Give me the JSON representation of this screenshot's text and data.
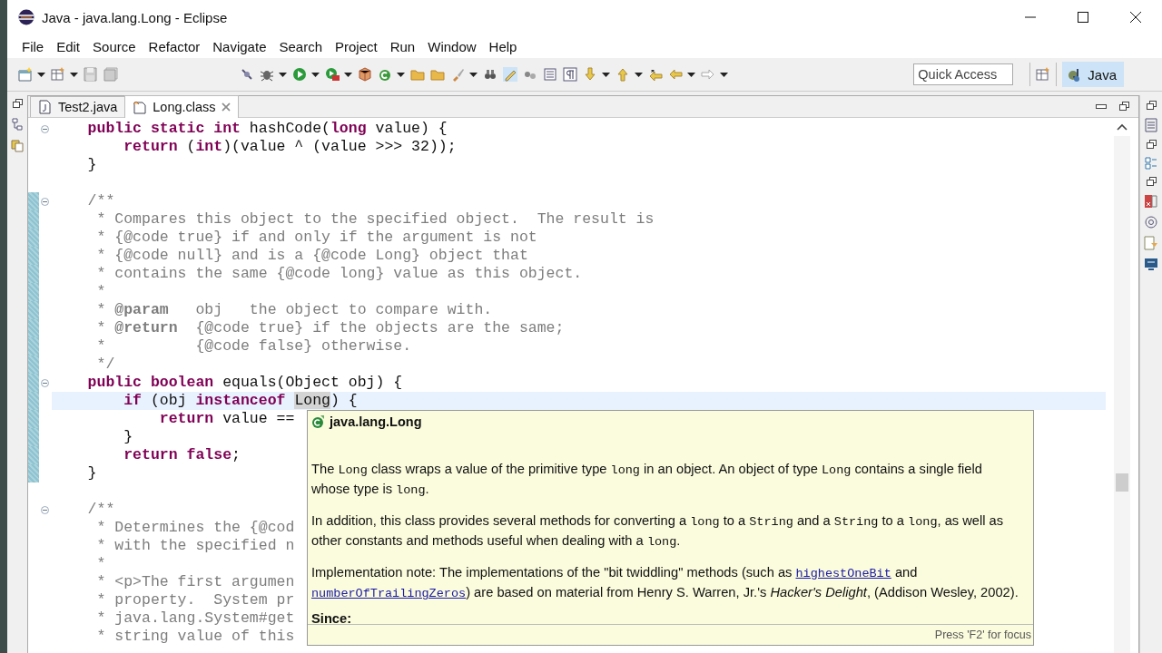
{
  "window": {
    "title": "Java - java.lang.Long - Eclipse"
  },
  "menu": [
    "File",
    "Edit",
    "Source",
    "Refactor",
    "Navigate",
    "Search",
    "Project",
    "Run",
    "Window",
    "Help"
  ],
  "quick_access": {
    "placeholder": "Quick Access"
  },
  "perspective": {
    "label": "Java",
    "selected": true
  },
  "tabs": [
    {
      "label": "Test2.java",
      "kind": "java",
      "selected": false
    },
    {
      "label": "Long.class",
      "kind": "class",
      "selected": true
    }
  ],
  "code_lines": [
    {
      "fold": true,
      "changed": false,
      "highlighted": false,
      "segments": [
        {
          "kind": "keyword",
          "text": "    public static int"
        },
        {
          "kind": "code",
          "text": " hashCode("
        },
        {
          "kind": "keyword",
          "text": "long"
        },
        {
          "kind": "code",
          "text": " value) {"
        }
      ]
    },
    {
      "fold": false,
      "changed": false,
      "highlighted": false,
      "segments": [
        {
          "kind": "keyword",
          "text": "        return"
        },
        {
          "kind": "code",
          "text": " ("
        },
        {
          "kind": "keyword",
          "text": "int"
        },
        {
          "kind": "code",
          "text": ")(value ^ (value >>> 32));"
        }
      ]
    },
    {
      "fold": false,
      "changed": false,
      "highlighted": false,
      "segments": [
        {
          "kind": "code",
          "text": "    }"
        }
      ]
    },
    {
      "fold": false,
      "changed": false,
      "highlighted": false
    },
    {
      "fold": true,
      "changed": true,
      "highlighted": false,
      "segments": [
        {
          "kind": "comment",
          "text": "    /**"
        }
      ]
    },
    {
      "fold": false,
      "changed": true,
      "highlighted": false,
      "segments": [
        {
          "kind": "comment",
          "text": "     * Compares this object to the specified object.  The result is"
        }
      ]
    },
    {
      "fold": false,
      "changed": true,
      "highlighted": false,
      "segments": [
        {
          "kind": "comment",
          "text": "     * {@code true} if and only if the argument is not"
        }
      ]
    },
    {
      "fold": false,
      "changed": true,
      "highlighted": false,
      "segments": [
        {
          "kind": "comment",
          "text": "     * {@code null} and is a {@code Long} object that"
        }
      ]
    },
    {
      "fold": false,
      "changed": true,
      "highlighted": false,
      "segments": [
        {
          "kind": "comment",
          "text": "     * contains the same {@code long} value as this object."
        }
      ]
    },
    {
      "fold": false,
      "changed": true,
      "highlighted": false,
      "segments": [
        {
          "kind": "comment",
          "text": "     *"
        }
      ]
    },
    {
      "fold": false,
      "changed": true,
      "highlighted": false,
      "segments": [
        {
          "kind": "comment",
          "text": "     * "
        },
        {
          "kind": "tag",
          "text": "@param"
        },
        {
          "kind": "comment",
          "text": "   obj   the object to compare with."
        }
      ]
    },
    {
      "fold": false,
      "changed": true,
      "highlighted": false,
      "segments": [
        {
          "kind": "comment",
          "text": "     * "
        },
        {
          "kind": "tag",
          "text": "@return"
        },
        {
          "kind": "comment",
          "text": "  {@code true} if the objects are the same;"
        }
      ]
    },
    {
      "fold": false,
      "changed": true,
      "highlighted": false,
      "segments": [
        {
          "kind": "comment",
          "text": "     *          {@code false} otherwise."
        }
      ]
    },
    {
      "fold": false,
      "changed": true,
      "highlighted": false,
      "segments": [
        {
          "kind": "comment",
          "text": "     */"
        }
      ]
    },
    {
      "fold": true,
      "changed": true,
      "highlighted": false,
      "segments": [
        {
          "kind": "keyword",
          "text": "    public boolean"
        },
        {
          "kind": "code",
          "text": " equals(Object obj) {"
        }
      ]
    },
    {
      "fold": false,
      "changed": true,
      "highlighted": true,
      "segments": [
        {
          "kind": "keyword",
          "text": "        if"
        },
        {
          "kind": "code",
          "text": " (obj "
        },
        {
          "kind": "keyword",
          "text": "instanceof "
        },
        {
          "kind": "occurrence",
          "text": "Long"
        },
        {
          "kind": "code",
          "text": ") {"
        }
      ]
    },
    {
      "fold": false,
      "changed": true,
      "highlighted": false,
      "segments": [
        {
          "kind": "keyword",
          "text": "            return"
        },
        {
          "kind": "code",
          "text": " value =="
        }
      ]
    },
    {
      "fold": false,
      "changed": true,
      "highlighted": false,
      "segments": [
        {
          "kind": "code",
          "text": "        }"
        }
      ]
    },
    {
      "fold": false,
      "changed": true,
      "highlighted": false,
      "segments": [
        {
          "kind": "keyword",
          "text": "        return false"
        },
        {
          "kind": "code",
          "text": ";"
        }
      ]
    },
    {
      "fold": false,
      "changed": true,
      "highlighted": false,
      "segments": [
        {
          "kind": "code",
          "text": "    }"
        }
      ]
    },
    {
      "fold": false,
      "changed": false,
      "highlighted": false
    },
    {
      "fold": true,
      "changed": false,
      "highlighted": false,
      "segments": [
        {
          "kind": "comment",
          "text": "    /**"
        }
      ]
    },
    {
      "fold": false,
      "changed": false,
      "highlighted": false,
      "segments": [
        {
          "kind": "comment",
          "text": "     * Determines the {@cod"
        }
      ]
    },
    {
      "fold": false,
      "changed": false,
      "highlighted": false,
      "segments": [
        {
          "kind": "comment",
          "text": "     * with the specified n"
        }
      ]
    },
    {
      "fold": false,
      "changed": false,
      "highlighted": false,
      "segments": [
        {
          "kind": "comment",
          "text": "     *"
        }
      ]
    },
    {
      "fold": false,
      "changed": false,
      "highlighted": false,
      "segments": [
        {
          "kind": "comment",
          "text": "     * <p>The first argumen"
        }
      ]
    },
    {
      "fold": false,
      "changed": false,
      "highlighted": false,
      "segments": [
        {
          "kind": "comment",
          "text": "     * property.  System pr"
        }
      ]
    },
    {
      "fold": false,
      "changed": false,
      "highlighted": false,
      "segments": [
        {
          "kind": "comment",
          "text": "     * java.lang.System#get"
        }
      ]
    },
    {
      "fold": false,
      "changed": false,
      "highlighted": false,
      "segments": [
        {
          "kind": "comment",
          "text": "     * string value of this"
        }
      ]
    }
  ],
  "hover_popup": {
    "title": "java.lang.Long",
    "paragraphs": [
      [
        {
          "kind": "text",
          "text": "The "
        },
        {
          "kind": "code",
          "text": "Long"
        },
        {
          "kind": "text",
          "text": " class wraps a value of the primitive type "
        },
        {
          "kind": "code",
          "text": "long"
        },
        {
          "kind": "text",
          "text": " in an object. An object of type "
        },
        {
          "kind": "code",
          "text": "Long"
        },
        {
          "kind": "text",
          "text": " contains a single field whose type is "
        },
        {
          "kind": "code",
          "text": "long"
        },
        {
          "kind": "text",
          "text": "."
        }
      ],
      [
        {
          "kind": "text",
          "text": "In addition, this class provides several methods for converting a "
        },
        {
          "kind": "code",
          "text": "long"
        },
        {
          "kind": "text",
          "text": " to a "
        },
        {
          "kind": "code",
          "text": "String"
        },
        {
          "kind": "text",
          "text": " and a "
        },
        {
          "kind": "code",
          "text": "String"
        },
        {
          "kind": "text",
          "text": " to a "
        },
        {
          "kind": "code",
          "text": "long"
        },
        {
          "kind": "text",
          "text": ", as well as other constants and methods useful when dealing with a "
        },
        {
          "kind": "code",
          "text": "long"
        },
        {
          "kind": "text",
          "text": "."
        }
      ],
      [
        {
          "kind": "text",
          "text": "Implementation note: The implementations of the \"bit twiddling\" methods (such as "
        },
        {
          "kind": "link",
          "text": "highestOneBit"
        },
        {
          "kind": "text",
          "text": " and "
        },
        {
          "kind": "link",
          "text": "numberOfTrailingZeros"
        },
        {
          "kind": "text",
          "text": ") are based on material from Henry S. Warren, Jr.'s "
        },
        {
          "kind": "italic",
          "text": "Hacker's Delight"
        },
        {
          "kind": "text",
          "text": ", (Addison Wesley, 2002)."
        }
      ]
    ],
    "section": "Since:",
    "footer": "Press 'F2' for focus"
  }
}
